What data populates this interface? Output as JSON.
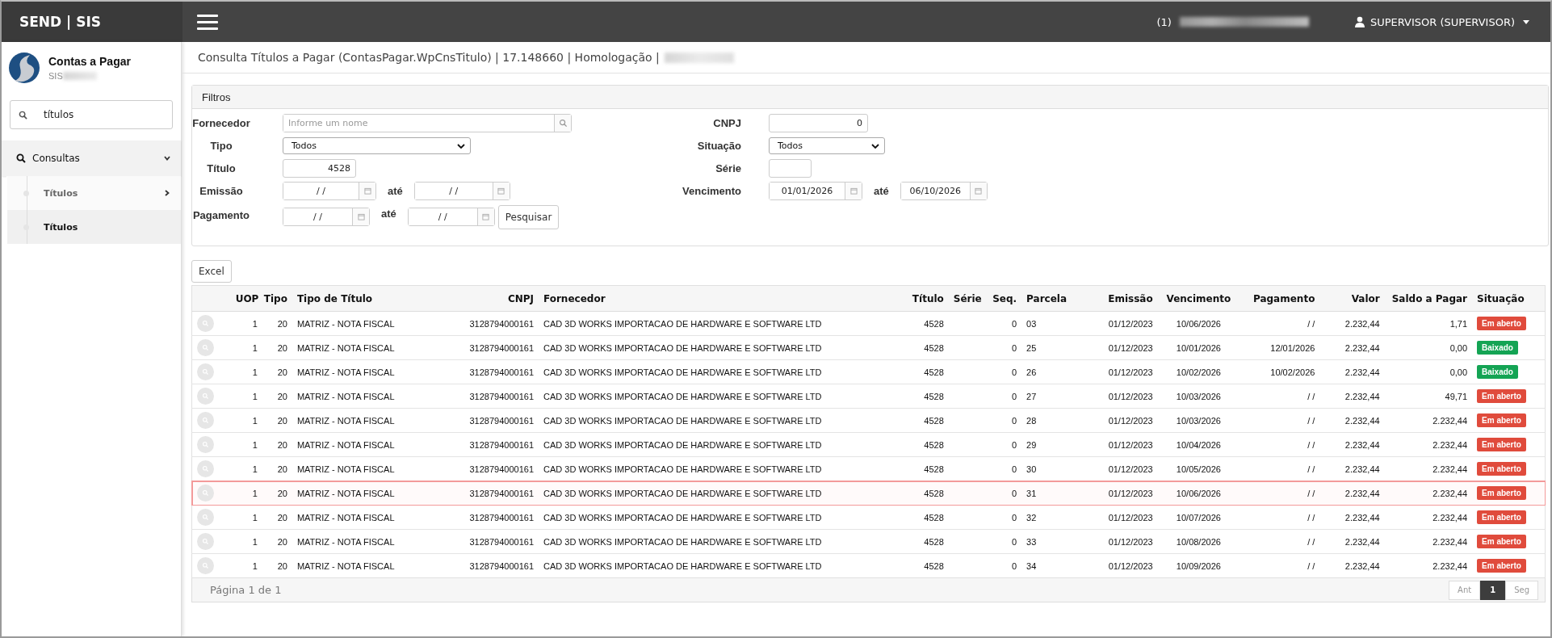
{
  "app": {
    "logo": "SEND | SIS"
  },
  "topbar": {
    "notice_count": "(1)",
    "user": "SUPERVISOR (SUPERVISOR)"
  },
  "sidebar": {
    "module_title": "Contas a Pagar",
    "module_subtitle": "SIS",
    "search": {
      "value": "títulos"
    },
    "menu": [
      {
        "label": "Consultas",
        "expanded": true,
        "children": [
          {
            "label": "Títulos",
            "kind": "submenu",
            "selected": false
          },
          {
            "label": "Títulos",
            "kind": "link",
            "selected": true
          }
        ]
      }
    ]
  },
  "page_title": "Consulta Títulos a Pagar (ContasPagar.WpCnsTitulo) | 17.148660 | Homologação |",
  "filters": {
    "title": "Filtros",
    "fornecedor": {
      "label": "Fornecedor",
      "placeholder": "Informe um nome"
    },
    "tipo": {
      "label": "Tipo",
      "value": "Todos"
    },
    "titulo": {
      "label": "Título",
      "value": "4528"
    },
    "emissao": {
      "label": "Emissão",
      "from": "/ /",
      "to_label": "até",
      "to": "/ /"
    },
    "pagamento": {
      "label": "Pagamento",
      "from": "/ /",
      "to_label": "até",
      "to": "/ /"
    },
    "search_button": "Pesquisar",
    "cnpj": {
      "label": "CNPJ",
      "value": "0"
    },
    "situacao": {
      "label": "Situação",
      "value": "Todos"
    },
    "serie": {
      "label": "Série"
    },
    "vencimento": {
      "label": "Vencimento",
      "from": "01/01/2026",
      "to_label": "até",
      "to": "06/10/2026"
    }
  },
  "excel_button": "Excel",
  "table": {
    "columns": [
      "UOP",
      "Tipo",
      "Tipo de Título",
      "CNPJ",
      "Fornecedor",
      "Título",
      "Série",
      "Seq.",
      "Parcela",
      "Emissão",
      "Vencimento",
      "Pagamento",
      "Valor",
      "Saldo a Pagar",
      "Situação"
    ],
    "rows": [
      {
        "selected": false,
        "cells": [
          "1",
          "20",
          "MATRIZ - NOTA FISCAL",
          "3128794000161",
          "CAD 3D WORKS IMPORTACAO DE HARDWARE E SOFTWARE LTD",
          "4528",
          "",
          "0",
          "03",
          "01/12/2023",
          "10/06/2026",
          "/ /",
          "2.232,44",
          "1,71"
        ],
        "status": {
          "label": "Em aberto",
          "kind": "open"
        }
      },
      {
        "selected": false,
        "cells": [
          "1",
          "20",
          "MATRIZ - NOTA FISCAL",
          "3128794000161",
          "CAD 3D WORKS IMPORTACAO DE HARDWARE E SOFTWARE LTD",
          "4528",
          "",
          "0",
          "25",
          "01/12/2023",
          "10/01/2026",
          "12/01/2026",
          "2.232,44",
          "0,00"
        ],
        "status": {
          "label": "Baixado",
          "kind": "settled"
        }
      },
      {
        "selected": false,
        "cells": [
          "1",
          "20",
          "MATRIZ - NOTA FISCAL",
          "3128794000161",
          "CAD 3D WORKS IMPORTACAO DE HARDWARE E SOFTWARE LTD",
          "4528",
          "",
          "0",
          "26",
          "01/12/2023",
          "10/02/2026",
          "10/02/2026",
          "2.232,44",
          "0,00"
        ],
        "status": {
          "label": "Baixado",
          "kind": "settled"
        }
      },
      {
        "selected": false,
        "cells": [
          "1",
          "20",
          "MATRIZ - NOTA FISCAL",
          "3128794000161",
          "CAD 3D WORKS IMPORTACAO DE HARDWARE E SOFTWARE LTD",
          "4528",
          "",
          "0",
          "27",
          "01/12/2023",
          "10/03/2026",
          "/ /",
          "2.232,44",
          "49,71"
        ],
        "status": {
          "label": "Em aberto",
          "kind": "open"
        }
      },
      {
        "selected": false,
        "cells": [
          "1",
          "20",
          "MATRIZ - NOTA FISCAL",
          "3128794000161",
          "CAD 3D WORKS IMPORTACAO DE HARDWARE E SOFTWARE LTD",
          "4528",
          "",
          "0",
          "28",
          "01/12/2023",
          "10/03/2026",
          "/ /",
          "2.232,44",
          "2.232,44"
        ],
        "status": {
          "label": "Em aberto",
          "kind": "open"
        }
      },
      {
        "selected": false,
        "cells": [
          "1",
          "20",
          "MATRIZ - NOTA FISCAL",
          "3128794000161",
          "CAD 3D WORKS IMPORTACAO DE HARDWARE E SOFTWARE LTD",
          "4528",
          "",
          "0",
          "29",
          "01/12/2023",
          "10/04/2026",
          "/ /",
          "2.232,44",
          "2.232,44"
        ],
        "status": {
          "label": "Em aberto",
          "kind": "open"
        }
      },
      {
        "selected": false,
        "cells": [
          "1",
          "20",
          "MATRIZ - NOTA FISCAL",
          "3128794000161",
          "CAD 3D WORKS IMPORTACAO DE HARDWARE E SOFTWARE LTD",
          "4528",
          "",
          "0",
          "30",
          "01/12/2023",
          "10/05/2026",
          "/ /",
          "2.232,44",
          "2.232,44"
        ],
        "status": {
          "label": "Em aberto",
          "kind": "open"
        }
      },
      {
        "selected": true,
        "cells": [
          "1",
          "20",
          "MATRIZ - NOTA FISCAL",
          "3128794000161",
          "CAD 3D WORKS IMPORTACAO DE HARDWARE E SOFTWARE LTD",
          "4528",
          "",
          "0",
          "31",
          "01/12/2023",
          "10/06/2026",
          "/ /",
          "2.232,44",
          "2.232,44"
        ],
        "status": {
          "label": "Em aberto",
          "kind": "open"
        }
      },
      {
        "selected": false,
        "cells": [
          "1",
          "20",
          "MATRIZ - NOTA FISCAL",
          "3128794000161",
          "CAD 3D WORKS IMPORTACAO DE HARDWARE E SOFTWARE LTD",
          "4528",
          "",
          "0",
          "32",
          "01/12/2023",
          "10/07/2026",
          "/ /",
          "2.232,44",
          "2.232,44"
        ],
        "status": {
          "label": "Em aberto",
          "kind": "open"
        }
      },
      {
        "selected": false,
        "cells": [
          "1",
          "20",
          "MATRIZ - NOTA FISCAL",
          "3128794000161",
          "CAD 3D WORKS IMPORTACAO DE HARDWARE E SOFTWARE LTD",
          "4528",
          "",
          "0",
          "33",
          "01/12/2023",
          "10/08/2026",
          "/ /",
          "2.232,44",
          "2.232,44"
        ],
        "status": {
          "label": "Em aberto",
          "kind": "open"
        }
      },
      {
        "selected": false,
        "cells": [
          "1",
          "20",
          "MATRIZ - NOTA FISCAL",
          "3128794000161",
          "CAD 3D WORKS IMPORTACAO DE HARDWARE E SOFTWARE LTD",
          "4528",
          "",
          "0",
          "34",
          "01/12/2023",
          "10/09/2026",
          "/ /",
          "2.232,44",
          "2.232,44"
        ],
        "status": {
          "label": "Em aberto",
          "kind": "open"
        }
      }
    ]
  },
  "pagination": {
    "summary": "Página 1 de 1",
    "prev": "Ant",
    "pages": [
      {
        "label": "1",
        "selected": true
      }
    ],
    "next": "Seg"
  }
}
